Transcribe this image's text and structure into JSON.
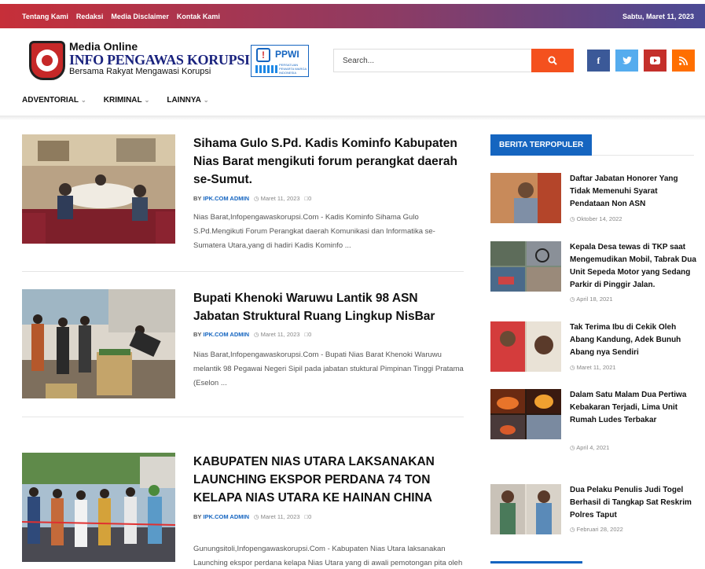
{
  "topbar": {
    "links": [
      "Tentang Kami",
      "Redaksi",
      "Media Disclaimer",
      "Kontak Kami"
    ],
    "date": "Sabtu, Maret 11, 2023"
  },
  "logo": {
    "line1": "Media Online",
    "line2": "INFO PENGAWAS KORUPSI",
    "line3": "Bersama Rakyat Mengawasi Korupsi",
    "partner_text": "PPWI",
    "partner_sub": "PERSATUAN PEWARTA WARGA INDONESIA"
  },
  "search": {
    "placeholder": "Search..."
  },
  "social": {
    "icons": [
      "facebook-icon",
      "twitter-icon",
      "youtube-icon",
      "rss-icon"
    ]
  },
  "nav": {
    "items": [
      "ADVENTORIAL",
      "KRIMINAL",
      "LAINNYA"
    ]
  },
  "articles": [
    {
      "title": "Sihama Gulo S.Pd. Kadis Kominfo Kabupaten Nias Barat mengikuti forum perangkat daerah se-Sumut.",
      "by": "BY",
      "author": "IPK.COM ADMIN",
      "date": "Maret 11, 2023",
      "comments": "0",
      "excerpt": "Nias Barat,Infopengawaskorupsi.Com - Kadis Kominfo Sihama Gulo S.Pd.Mengikuti Forum Perangkat daerah Komunikasi dan Informatika se-Sumatera Utara,yang di hadiri Kadis Kominfo ..."
    },
    {
      "title": "Bupati Khenoki Waruwu Lantik 98 ASN Jabatan Struktural Ruang Lingkup NisBar",
      "by": "BY",
      "author": "IPK.COM ADMIN",
      "date": "Maret 11, 2023",
      "comments": "0",
      "excerpt": "Nias Barat,Infopengawaskorupsi.Com - Bupati Nias Barat Khenoki Waruwu melantik 98 Pegawai Negeri Sipil pada jabatan stuktural Pimpinan Tinggi Pratama (Eselon ..."
    },
    {
      "title": "KABUPATEN NIAS UTARA LAKSANAKAN LAUNCHING EKSPOR PERDANA 74 TON KELAPA NIAS UTARA KE HAINAN CHINA",
      "by": "BY",
      "author": "IPK.COM ADMIN",
      "date": "Maret 11, 2023",
      "comments": "0",
      "excerpt": "Gunungsitoli,Infopengawaskorupsi.Com - Kabupaten Nias Utara laksanakan Launching ekspor perdana kelapa Nias Utara yang di awali pemotongan pita oleh Gubernur sumatera ..."
    }
  ],
  "sidebar": {
    "heading": "BERITA TERPOPULER",
    "items": [
      {
        "title": "Daftar Jabatan Honorer Yang Tidak Memenuhi Syarat Pendataan Non ASN",
        "date": "Oktober 14, 2022"
      },
      {
        "title": "Kepala Desa tewas di TKP saat Mengemudikan Mobil, Tabrak Dua Unit Sepeda Motor yang Sedang Parkir di Pinggir Jalan.",
        "date": "April 18, 2021"
      },
      {
        "title": "Tak Terima Ibu di Cekik Oleh Abang Kandung, Adek Bunuh Abang nya Sendiri",
        "date": "Maret 11, 2021"
      },
      {
        "title": "Dalam Satu Malam Dua Pertiwa Kebakaran Terjadi, Lima Unit Rumah Ludes Terbakar",
        "date": "April 4, 2021"
      },
      {
        "title": "Dua Pelaku Penulis Judi Togel Berhasil di Tangkap Sat Reskrim Polres Taput",
        "date": "Februari 28, 2022"
      }
    ]
  }
}
